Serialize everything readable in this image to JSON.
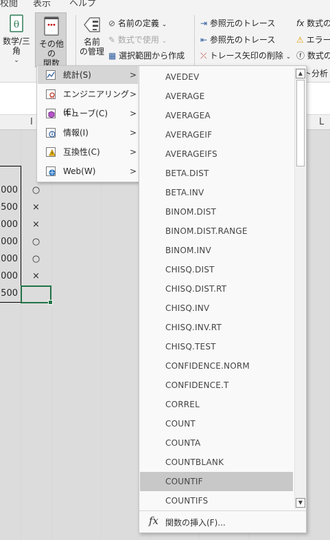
{
  "ribbon": {
    "tabs": [
      "校閲",
      "表示",
      "ヘルプ"
    ],
    "math_trig": "数学/三角",
    "more_functions": [
      "その他の",
      "関数"
    ],
    "name_manager": [
      "名前",
      "の管理"
    ],
    "define_name": "名前の定義",
    "use_in_formula": "数式で使用",
    "create_from_selection": "選択範囲から作成",
    "trace_precedents": "参照元のトレース",
    "trace_dependents": "参照先のトレース",
    "remove_arrows": "トレース矢印の削除",
    "show_formulas": "数式の",
    "error_checking": "エラー",
    "evaluate_formula": "数式の",
    "analysis": "ト分析"
  },
  "sheet": {
    "col_letters": [
      "I",
      "L"
    ],
    "rows": [
      {
        "value": "000",
        "mark": "○"
      },
      {
        "value": "500",
        "mark": "×"
      },
      {
        "value": "000",
        "mark": "×"
      },
      {
        "value": "000",
        "mark": "○"
      },
      {
        "value": "000",
        "mark": "○"
      },
      {
        "value": "000",
        "mark": "×"
      },
      {
        "value": "500",
        "mark": ""
      }
    ]
  },
  "category_menu": {
    "items": [
      {
        "label": "統計(S)",
        "icon": "statistics-icon",
        "active": true
      },
      {
        "label": "エンジニアリング(E)",
        "icon": "engineering-icon",
        "active": false
      },
      {
        "label": "キューブ(C)",
        "icon": "cube-icon",
        "active": false
      },
      {
        "label": "情報(I)",
        "icon": "information-icon",
        "active": false
      },
      {
        "label": "互換性(C)",
        "icon": "compatibility-icon",
        "active": false
      },
      {
        "label": "Web(W)",
        "icon": "web-icon",
        "active": false
      }
    ],
    "arrow": ">"
  },
  "function_menu": {
    "items": [
      "AVEDEV",
      "AVERAGE",
      "AVERAGEA",
      "AVERAGEIF",
      "AVERAGEIFS",
      "BETA.DIST",
      "BETA.INV",
      "BINOM.DIST",
      "BINOM.DIST.RANGE",
      "BINOM.INV",
      "CHISQ.DIST",
      "CHISQ.DIST.RT",
      "CHISQ.INV",
      "CHISQ.INV.RT",
      "CHISQ.TEST",
      "CONFIDENCE.NORM",
      "CONFIDENCE.T",
      "CORREL",
      "COUNT",
      "COUNTA",
      "COUNTBLANK",
      "COUNTIF",
      "COUNTIFS"
    ],
    "hovered": "COUNTIF",
    "insert_function": "関数の挿入(F)...",
    "fx_symbol": "fx"
  },
  "colors": {
    "selection": "#217346",
    "menu_bg": "#f9f9f9",
    "hover_bg": "#c8c8c8"
  }
}
